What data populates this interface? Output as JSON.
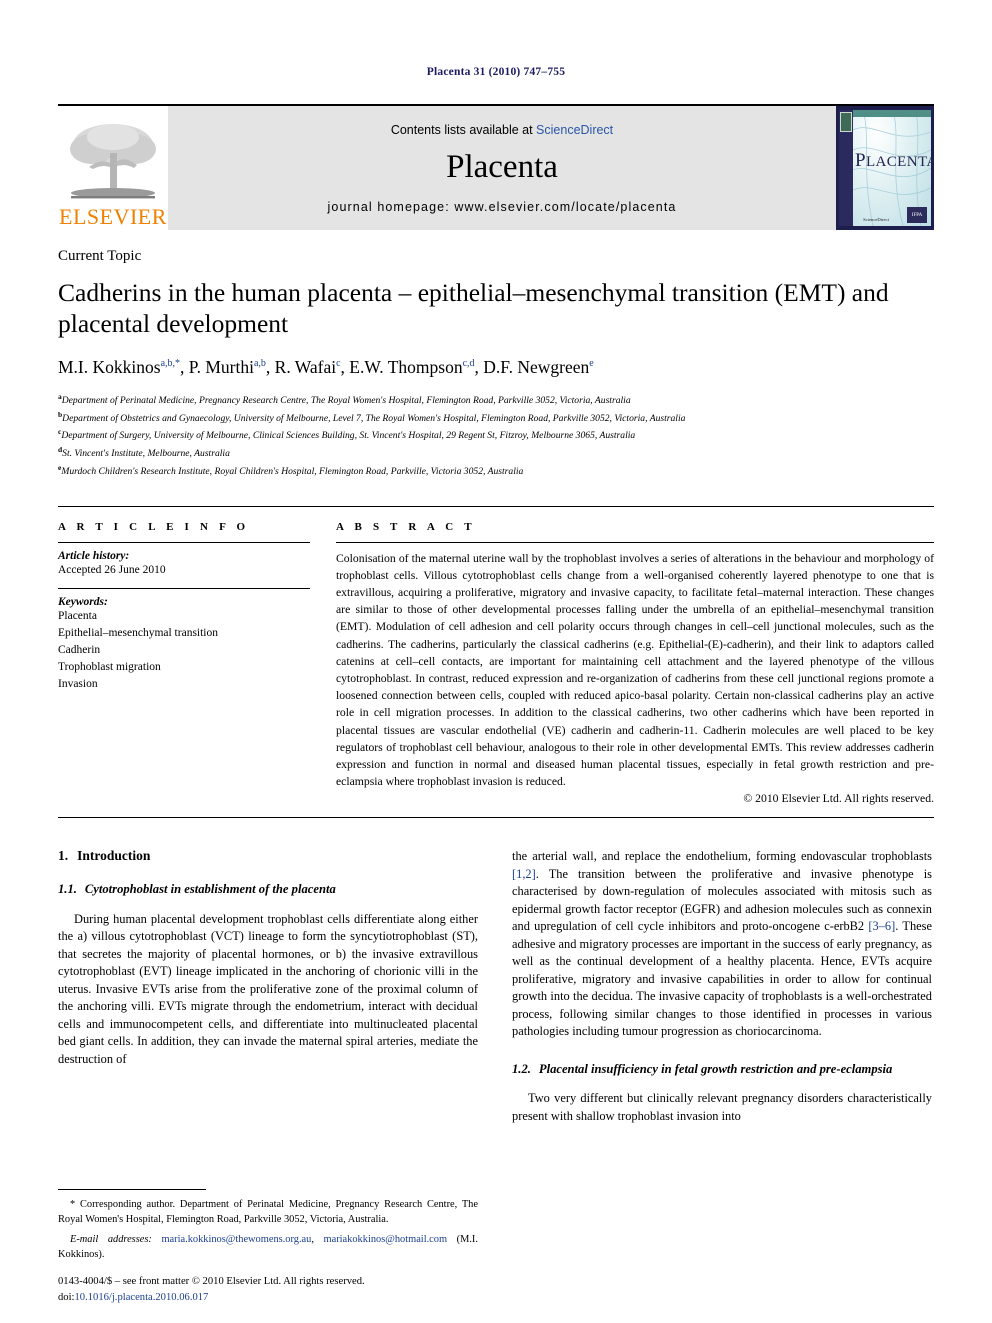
{
  "running_head": "Placenta 31 (2010) 747–755",
  "masthead": {
    "contents_prefix": "Contents lists available at ",
    "sciencedirect": "ScienceDirect",
    "journal_name": "Placenta",
    "homepage": "journal homepage: www.elsevier.com/locate/placenta",
    "publisher_logo_text": "ELSEVIER",
    "cover_title_first": "P",
    "cover_title_rest": "LACENTA",
    "cover_sciencedirect": "ScienceDirect",
    "cover_badge": "IFPA"
  },
  "article": {
    "type_label": "Current Topic",
    "title": "Cadherins in the human placenta – epithelial–mesenchymal transition (EMT) and placental development",
    "authors": [
      {
        "name": "M.I. Kokkinos",
        "sup": "a,b,*"
      },
      {
        "name": "P. Murthi",
        "sup": "a,b"
      },
      {
        "name": "R. Wafai",
        "sup": "c"
      },
      {
        "name": "E.W. Thompson",
        "sup": "c,d"
      },
      {
        "name": "D.F. Newgreen",
        "sup": "e"
      }
    ],
    "affiliations": [
      {
        "mark": "a",
        "text": "Department of Perinatal Medicine, Pregnancy Research Centre, The Royal Women's Hospital, Flemington Road, Parkville 3052, Victoria, Australia"
      },
      {
        "mark": "b",
        "text": "Department of Obstetrics and Gynaecology, University of Melbourne, Level 7, The Royal Women's Hospital, Flemington Road, Parkville 3052, Victoria, Australia"
      },
      {
        "mark": "c",
        "text": "Department of Surgery, University of Melbourne, Clinical Sciences Building, St. Vincent's Hospital, 29 Regent St, Fitzroy, Melbourne 3065, Australia"
      },
      {
        "mark": "d",
        "text": "St. Vincent's Institute, Melbourne, Australia"
      },
      {
        "mark": "e",
        "text": "Murdoch Children's Research Institute, Royal Children's Hospital, Flemington Road, Parkville, Victoria 3052, Australia"
      }
    ]
  },
  "article_info": {
    "heading": "A R T I C L E   I N F O",
    "history_label": "Article history:",
    "history_lines": "Accepted 26 June 2010",
    "keywords_label": "Keywords:",
    "keywords": [
      "Placenta",
      "Epithelial–mesenchymal transition",
      "Cadherin",
      "Trophoblast migration",
      "Invasion"
    ]
  },
  "abstract": {
    "heading": "A B S T R A C T",
    "text": "Colonisation of the maternal uterine wall by the trophoblast involves a series of alterations in the behaviour and morphology of trophoblast cells. Villous cytotrophoblast cells change from a well-organised coherently layered phenotype to one that is extravillous, acquiring a proliferative, migratory and invasive capacity, to facilitate fetal–maternal interaction. These changes are similar to those of other developmental processes falling under the umbrella of an epithelial–mesenchymal transition (EMT). Modulation of cell adhesion and cell polarity occurs through changes in cell–cell junctional molecules, such as the cadherins. The cadherins, particularly the classical cadherins (e.g. Epithelial-(E)-cadherin), and their link to adaptors called catenins at cell–cell contacts, are important for maintaining cell attachment and the layered phenotype of the villous cytotrophoblast. In contrast, reduced expression and re-organization of cadherins from these cell junctional regions promote a loosened connection between cells, coupled with reduced apico-basal polarity. Certain non-classical cadherins play an active role in cell migration processes. In addition to the classical cadherins, two other cadherins which have been reported in placental tissues are vascular endothelial (VE) cadherin and cadherin-11. Cadherin molecules are well placed to be key regulators of trophoblast cell behaviour, analogous to their role in other developmental EMTs. This review addresses cadherin expression and function in normal and diseased human placental tissues, especially in fetal growth restriction and pre-eclampsia where trophoblast invasion is reduced.",
    "copyright": "© 2010 Elsevier Ltd. All rights reserved."
  },
  "body": {
    "section1_num": "1.",
    "section1_title": "Introduction",
    "section11_num": "1.1.",
    "section11_title": "Cytotrophoblast in establishment of the placenta",
    "para1": "During human placental development trophoblast cells differentiate along either the a) villous cytotrophoblast (VCT) lineage to form the syncytiotrophoblast (ST), that secretes the majority of placental hormones, or b) the invasive extravillous cytotrophoblast (EVT) lineage implicated in the anchoring of chorionic villi in the uterus. Invasive EVTs arise from the proliferative zone of the proximal column of the anchoring villi. EVTs migrate through the endometrium, interact with decidual cells and immunocompetent cells, and differentiate into multinucleated placental bed giant cells. In addition, they can invade the maternal spiral arteries, mediate the destruction of",
    "para2_pre": "the arterial wall, and replace the endothelium, forming endovascular trophoblasts ",
    "para2_ref1": "[1,2]",
    "para2_mid": ". The transition between the proliferative and invasive phenotype is characterised by down-regulation of molecules associated with mitosis such as epidermal growth factor receptor (EGFR) and adhesion molecules such as connexin and upregulation of cell cycle inhibitors and proto-oncogene c-erbB2 ",
    "para2_ref2": "[3–6]",
    "para2_post": ". These adhesive and migratory processes are important in the success of early pregnancy, as well as the continual development of a healthy placenta. Hence, EVTs acquire proliferative, migratory and invasive capabilities in order to allow for continual growth into the decidua. The invasive capacity of trophoblasts is a well-orchestrated process, following similar changes to those identified in processes in various pathologies including tumour progression as choriocarcinoma.",
    "section12_num": "1.2.",
    "section12_title": "Placental insufficiency in fetal growth restriction and pre-eclampsia",
    "para3": "Two very different but clinically relevant pregnancy disorders characteristically present with shallow trophoblast invasion into"
  },
  "footnotes": {
    "corresponding": "* Corresponding author. Department of Perinatal Medicine, Pregnancy Research Centre, The Royal Women's Hospital, Flemington Road, Parkville 3052, Victoria, Australia.",
    "email_label": "E-mail addresses:",
    "email1": "maria.kokkinos@thewomens.org.au",
    "email2": "mariakokkinos@hotmail.com",
    "email_owner": "(M.I. Kokkinos).",
    "imprint_line1": "0143-4004/$ – see front matter © 2010 Elsevier Ltd. All rights reserved.",
    "imprint_doi_label": "doi:",
    "imprint_doi": "10.1016/j.placenta.2010.06.017"
  },
  "colors": {
    "link": "#1b3f8f",
    "running_head": "#1b1b64",
    "elsevier_orange": "#f08000",
    "masthead_bg": "#e4e4e4"
  }
}
